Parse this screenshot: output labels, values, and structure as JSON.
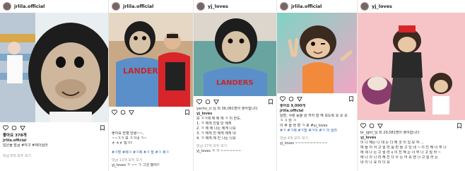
{
  "posts": [
    {
      "username": "jrlila.official",
      "likes": "좋아요 378개",
      "caption_user": "jrlila.official",
      "caption_text": "달은물 발굴 #야구 #제이릴라",
      "comments_link": "댓글 8개 모두 보기",
      "lines": []
    },
    {
      "username": "jrlila.official",
      "likes": "",
      "caption_user": "",
      "caption_text": "",
      "comments_link": "",
      "lines": [
        "좋아요 한영 안녕~~,",
        "~~ㅋㅋ 보 ㅋㅋ내 ㅋ~",
        "ㅎ ㅎㅎ 뭐ㅋ?",
        "#ㅋ할 #제ㅋ #ㅋ제 #ㅋ 발 #ㅋ 제ㅋ",
        "댓글 13개 모두 보기",
        "yj_loves ㅋ ~~ ㅋ 그것 했어!!"
      ],
      "jersey": "LANDER"
    },
    {
      "username": "yj_loves",
      "likes": "yecho_ci 님 외 36,061명이 좋아합니다",
      "caption_user": "yj_loves",
      "caption_text": "보 ㅋㅋ에 에 에 에 ㅋ 이 한도.",
      "comments_link": "",
      "lines": [
        "1. ㅋ 에게 친절 단 에게",
        "2. ㅋ 에 에 나는 에게 나요",
        "3. ㅋ 에게 친 에게 에게 내",
        "4. ㅋ 에게 에 친 나는 나요",
        "댓글 27개 모두 보기",
        "yj_loves ㅋ ㅋ ~~~~~~~"
      ],
      "jersey": "LANDERS"
    },
    {
      "username": "jrlila.official",
      "likes": "",
      "caption_user": "",
      "caption_text": "",
      "comments_link": "",
      "lines": [
        "좋아요 9,000개",
        "jrlila.official",
        "달밤, 사랑 동물 원 까지 잘 해 보도록 요 요 요",
        "ㅋ ㅋ 만 ㅋ",
        "이 후 을 현 할 ㅋ 로 #yj_loves",
        "#ㅋ #ㅋ제 #ㅋ발 #ㅋ이 #ㅋ 이 릴라",
        "댓글 4개 모두 보기",
        "yj_loves ~~~~~~~~~~~"
      ]
    },
    {
      "username": "yj_loves",
      "likes": "br_ight_님 외 29,581명이 좋아합니다",
      "caption_user": "yj_loves",
      "caption_text": "이 나 예는 나 대 는 다 에 것 이 있 모 자 ...",
      "comments_link": "",
      "lines": [
        "에 들 어 서 고 릴 라 를 만 들 고 있 네 ~ 이 진 해 너 무 나",
        "에 세 나 는 고 릴 라 x 이 진 해 는 너 무 나 고 릴 라 ~",
        "에 나 의 나 라 해 진 다 우 는 어 요 엔 나 고 릴 라 는",
        "내 이 나 요 이 다 요"
      ]
    }
  ],
  "colors": {
    "link": "#2b5aa8",
    "jersey": "#5a8fc9",
    "panel_green": "#6cc6a6",
    "panel_pink": "#f6c4c6"
  }
}
